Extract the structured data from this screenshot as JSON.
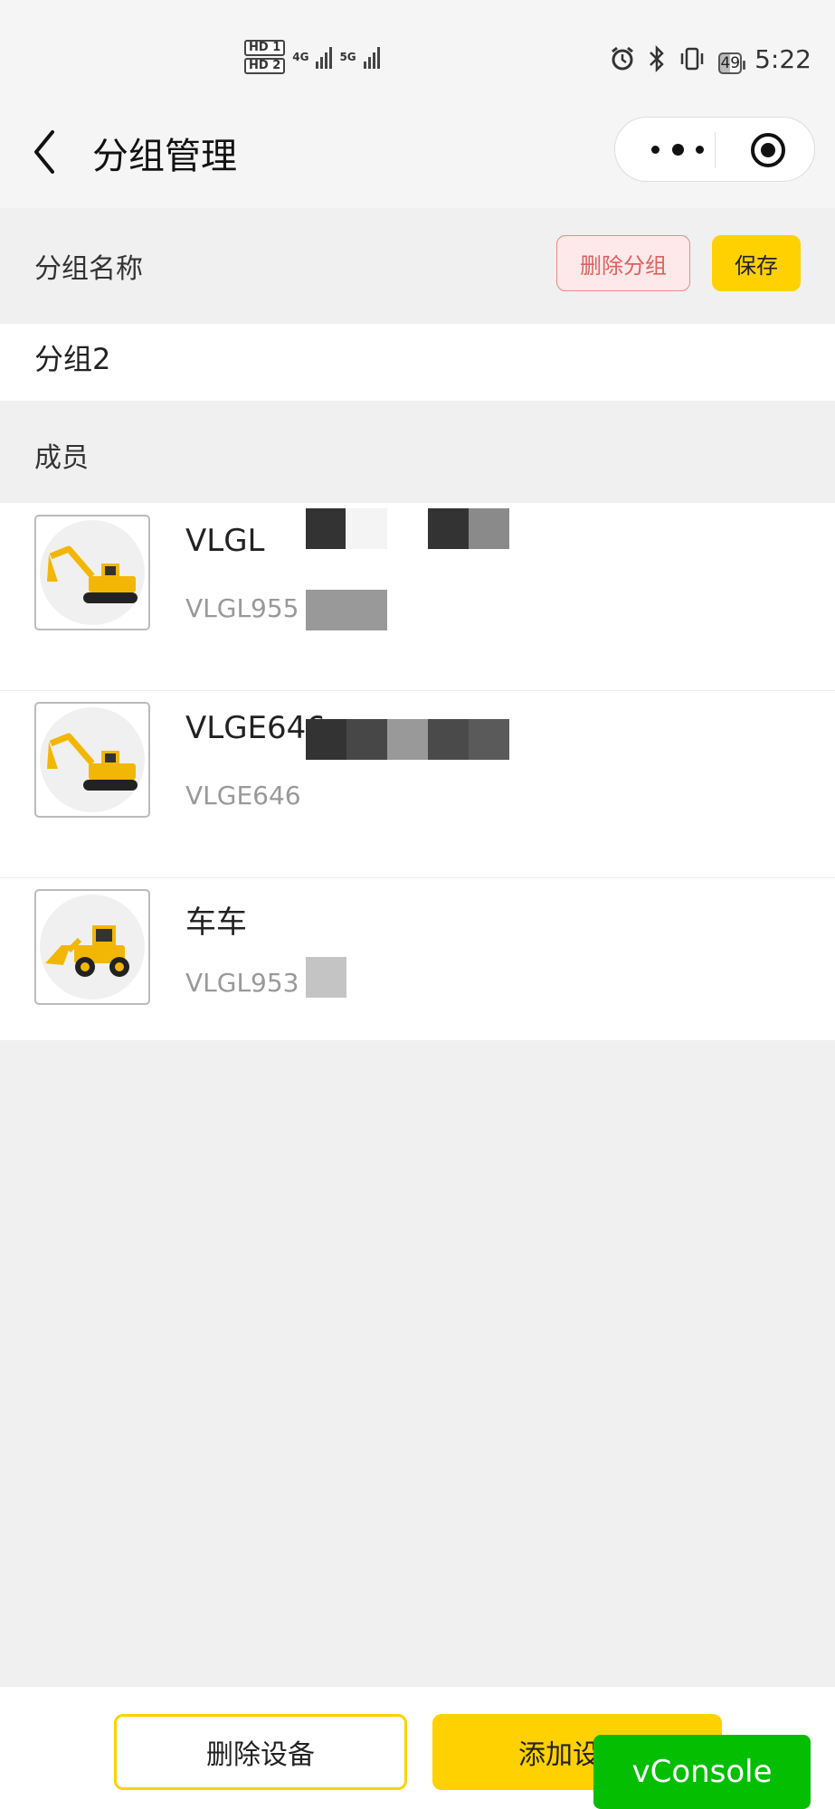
{
  "status_bar": {
    "hd1": "HD 1",
    "hd2": "HD 2",
    "net1": "4G",
    "net2": "5G",
    "battery": "49",
    "time": "5:22"
  },
  "nav": {
    "title": "分组管理"
  },
  "group": {
    "name_label": "分组名称",
    "delete_group_label": "删除分组",
    "save_label": "保存",
    "name_value": "分组2",
    "members_label": "成员"
  },
  "devices": [
    {
      "name": "VLGL",
      "code": "VLGL955",
      "type": "excavator"
    },
    {
      "name": "VLGE646",
      "code": "VLGE646",
      "type": "excavator"
    },
    {
      "name": "车车",
      "code": "VLGL953",
      "type": "loader"
    }
  ],
  "bottom": {
    "delete_device_label": "删除设备",
    "add_device_label": "添加设",
    "vconsole_label": "vConsole"
  },
  "colors": {
    "accent": "#ffd100",
    "danger": "#e06060",
    "vconsole": "#04be02",
    "background": "#f0f0f0"
  }
}
